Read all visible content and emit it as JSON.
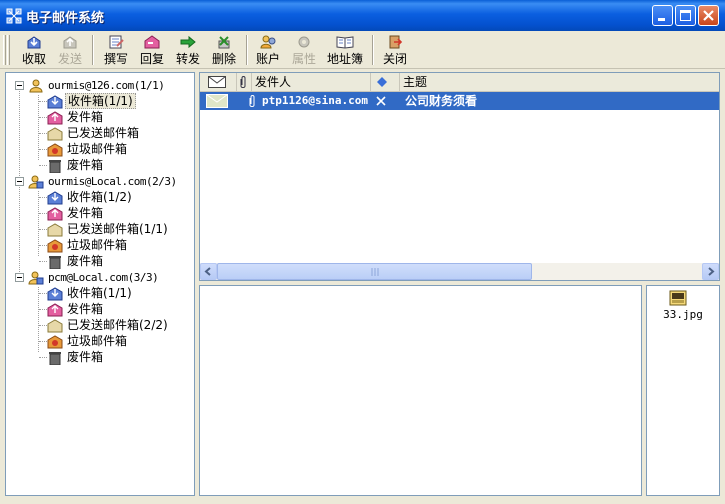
{
  "window": {
    "title": "电子邮件系统"
  },
  "toolbar": {
    "items": [
      {
        "label": "收取",
        "icon": "receive-icon",
        "enabled": true
      },
      {
        "label": "发送",
        "icon": "send-icon",
        "enabled": false
      },
      {
        "label": "撰写",
        "icon": "compose-icon",
        "enabled": true
      },
      {
        "label": "回复",
        "icon": "reply-icon",
        "enabled": true
      },
      {
        "label": "转发",
        "icon": "forward-icon",
        "enabled": true
      },
      {
        "label": "删除",
        "icon": "delete-icon",
        "enabled": true
      },
      {
        "label": "账户",
        "icon": "account-icon",
        "enabled": true
      },
      {
        "label": "属性",
        "icon": "properties-icon",
        "enabled": false
      },
      {
        "label": "地址簿",
        "icon": "address-book-icon",
        "enabled": true
      },
      {
        "label": "关闭",
        "icon": "close-app-icon",
        "enabled": true
      }
    ]
  },
  "tree": {
    "accounts": [
      {
        "label": "ourmis@126.com(1/1)",
        "folders": [
          {
            "label": "收件箱(1/1)",
            "selected": true
          },
          {
            "label": "发件箱"
          },
          {
            "label": "已发送邮件箱"
          },
          {
            "label": "垃圾邮件箱"
          },
          {
            "label": "废件箱"
          }
        ]
      },
      {
        "label": "ourmis@Local.com(2/3)",
        "folders": [
          {
            "label": "收件箱(1/2)"
          },
          {
            "label": "发件箱"
          },
          {
            "label": "已发送邮件箱(1/1)"
          },
          {
            "label": "垃圾邮件箱"
          },
          {
            "label": "废件箱"
          }
        ]
      },
      {
        "label": "pcm@Local.com(3/3)",
        "folders": [
          {
            "label": "收件箱(1/1)"
          },
          {
            "label": "发件箱"
          },
          {
            "label": "已发送邮件箱(2/2)"
          },
          {
            "label": "垃圾邮件箱"
          },
          {
            "label": "废件箱"
          }
        ]
      }
    ]
  },
  "message_list": {
    "columns": {
      "sender": "发件人",
      "subject": "主题"
    },
    "rows": [
      {
        "sender": "ptp1126@sina.com",
        "subject": "公司财务须看",
        "selected": true
      }
    ]
  },
  "attachments": [
    {
      "name": "33.jpg",
      "type": "JPG"
    }
  ],
  "colors": {
    "selection": "#316ac5",
    "titlebar": "#0b5fe0"
  }
}
